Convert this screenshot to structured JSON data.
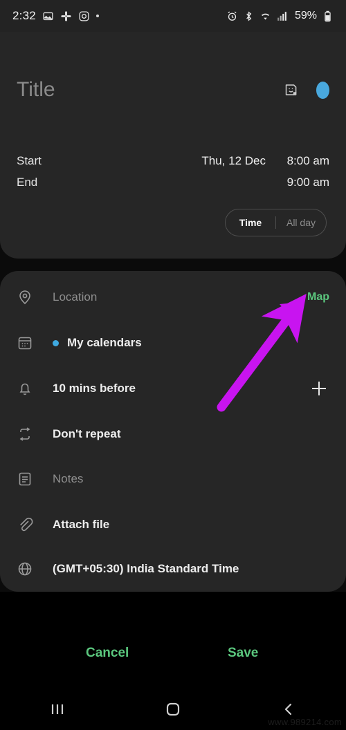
{
  "statusbar": {
    "time": "2:32",
    "left_icons": [
      "photo-icon",
      "slack-icon",
      "instagram-icon",
      "dot-indicator"
    ],
    "right_icons": [
      "alarm-icon",
      "bluetooth-icon",
      "wifi-icon",
      "signal-icon"
    ],
    "battery_percent": "59%"
  },
  "event": {
    "title_value": "",
    "title_placeholder": "Title",
    "sticker_icon": "sticker-smiley-icon",
    "color_dot": "#49a8dd",
    "start": {
      "label": "Start",
      "date": "Thu, 12 Dec",
      "time": "8:00 am"
    },
    "end": {
      "label": "End",
      "date": "",
      "time": "9:00 am"
    },
    "mode_toggle": {
      "selected": "Time",
      "options": [
        "Time",
        "All day"
      ]
    }
  },
  "details": {
    "location": {
      "icon": "location-pin-icon",
      "text": "Location",
      "placeholder": true,
      "action": "Map"
    },
    "calendar": {
      "icon": "calendar-icon",
      "text": "My calendars",
      "dot_color": "#3fa9e0"
    },
    "alert": {
      "icon": "bell-icon",
      "text": "10 mins before",
      "add_label": "+"
    },
    "repeat": {
      "icon": "repeat-icon",
      "text": "Don't repeat"
    },
    "notes": {
      "icon": "notes-icon",
      "text": "Notes",
      "placeholder": true
    },
    "attach": {
      "icon": "paperclip-icon",
      "text": "Attach file"
    },
    "timezone": {
      "icon": "globe-icon",
      "text": "(GMT+05:30) India Standard Time"
    }
  },
  "annotation": {
    "arrow_color": "#c814f0",
    "points_to": "Map"
  },
  "footer": {
    "cancel_label": "Cancel",
    "save_label": "Save",
    "accent": "#5bc77e"
  },
  "navbar": {
    "recents": "recents-icon",
    "home": "home-icon",
    "back": "back-icon"
  },
  "watermark": "www.989214.com"
}
